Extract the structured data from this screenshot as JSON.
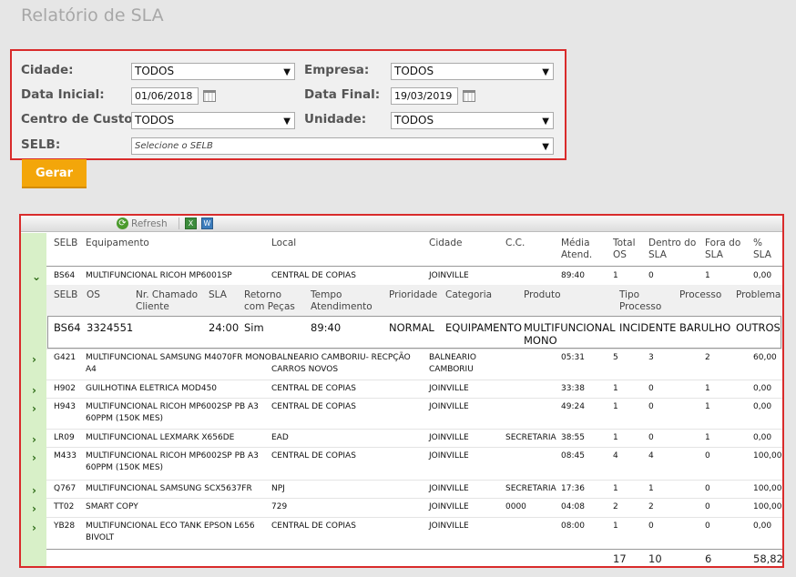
{
  "page_title": "Relatório de SLA",
  "filters": {
    "cidade_label": "Cidade:",
    "cidade_value": "TODOS",
    "empresa_label": "Empresa:",
    "empresa_value": "TODOS",
    "data_inicial_label": "Data Inicial:",
    "data_inicial_value": "01/06/2018",
    "data_final_label": "Data Final:",
    "data_final_value": "19/03/2019",
    "centro_label": "Centro de Custo:",
    "centro_value": "TODOS",
    "unidade_label": "Unidade:",
    "unidade_value": "TODOS",
    "selb_label": "SELB:",
    "selb_placeholder": "Selecione o SELB"
  },
  "gerar_label": "Gerar",
  "toolbar": {
    "refresh_label": "Refresh"
  },
  "columns": {
    "selb": "SELB",
    "equipamento": "Equipamento",
    "local": "Local",
    "cidade": "Cidade",
    "cc": "C.C.",
    "media1": "Média",
    "media2": "Atend.",
    "total1": "Total",
    "total2": "OS",
    "dentro1": "Dentro do",
    "dentro2": "SLA",
    "fora1": "Fora do",
    "fora2": "SLA",
    "pct1": "%",
    "pct2": "SLA"
  },
  "rows": [
    {
      "selb": "BS64",
      "equip": [
        "MULTIFUNCIONAL RICOH MP6001SP"
      ],
      "local": [
        "CENTRAL DE COPIAS"
      ],
      "cidade": [
        "JOINVILLE"
      ],
      "cc": "",
      "media": "89:40",
      "total": "1",
      "dentro": "0",
      "fora": "1",
      "pct": "0,00"
    },
    {
      "selb": "G421",
      "equip": [
        "MULTIFUNCIONAL SAMSUNG M4070FR MONO",
        "A4"
      ],
      "local": [
        "BALNEARIO CAMBORIU- RECPÇÃO",
        "CARROS NOVOS"
      ],
      "cidade": [
        "BALNEARIO",
        "CAMBORIU"
      ],
      "cc": "",
      "media": "05:31",
      "total": "5",
      "dentro": "3",
      "fora": "2",
      "pct": "60,00"
    },
    {
      "selb": "H902",
      "equip": [
        "GUILHOTINA ELETRICA MOD450"
      ],
      "local": [
        "CENTRAL DE COPIAS"
      ],
      "cidade": [
        "JOINVILLE"
      ],
      "cc": "",
      "media": "33:38",
      "total": "1",
      "dentro": "0",
      "fora": "1",
      "pct": "0,00"
    },
    {
      "selb": "H943",
      "equip": [
        "MULTIFUNCIONAL RICOH MP6002SP PB A3",
        "60PPM (150K MES)"
      ],
      "local": [
        "CENTRAL DE COPIAS"
      ],
      "cidade": [
        "JOINVILLE"
      ],
      "cc": "",
      "media": "49:24",
      "total": "1",
      "dentro": "0",
      "fora": "1",
      "pct": "0,00"
    },
    {
      "selb": "LR09",
      "equip": [
        "MULTIFUNCIONAL LEXMARK X656DE"
      ],
      "local": [
        "EAD"
      ],
      "cidade": [
        "JOINVILLE"
      ],
      "cc": "SECRETARIA",
      "media": "38:55",
      "total": "1",
      "dentro": "0",
      "fora": "1",
      "pct": "0,00"
    },
    {
      "selb": "M433",
      "equip": [
        "MULTIFUNCIONAL RICOH MP6002SP PB A3",
        "60PPM (150K MES)"
      ],
      "local": [
        "CENTRAL DE COPIAS"
      ],
      "cidade": [
        "JOINVILLE"
      ],
      "cc": "",
      "media": "08:45",
      "total": "4",
      "dentro": "4",
      "fora": "0",
      "pct": "100,00"
    },
    {
      "selb": "Q767",
      "equip": [
        "MULTIFUNCIONAL SAMSUNG SCX5637FR"
      ],
      "local": [
        "NPJ"
      ],
      "cidade": [
        "JOINVILLE"
      ],
      "cc": "SECRETARIA",
      "media": "17:36",
      "total": "1",
      "dentro": "1",
      "fora": "0",
      "pct": "100,00"
    },
    {
      "selb": "TT02",
      "equip": [
        "SMART COPY"
      ],
      "local": [
        "729"
      ],
      "cidade": [
        "JOINVILLE"
      ],
      "cc": "0000",
      "media": "04:08",
      "total": "2",
      "dentro": "2",
      "fora": "0",
      "pct": "100,00"
    },
    {
      "selb": "YB28",
      "equip": [
        "MULTIFUNCIONAL ECO TANK EPSON L656",
        "BIVOLT"
      ],
      "local": [
        "CENTRAL DE COPIAS"
      ],
      "cidade": [
        "JOINVILLE"
      ],
      "cc": "",
      "media": "08:00",
      "total": "1",
      "dentro": "0",
      "fora": "0",
      "pct": "0,00"
    }
  ],
  "subgrid": {
    "headers": {
      "selb": "SELB",
      "os": "OS",
      "chamado1": "Nr. Chamado",
      "chamado2": "Cliente",
      "sla": "SLA",
      "retorno1": "Retorno",
      "retorno2": "com Peças",
      "tempo1": "Tempo",
      "tempo2": "Atendimento",
      "prioridade": "Prioridade",
      "categoria": "Categoria",
      "produto": "Produto",
      "tipo1": "Tipo",
      "tipo2": "Processo",
      "processo": "Processo",
      "problema": "Problema"
    },
    "row": {
      "selb": "BS64",
      "os": "3324551",
      "chamado": "",
      "sla": "24:00",
      "retorno": "Sim",
      "tempo": "89:40",
      "prioridade": "NORMAL",
      "categoria": "EQUIPAMENTO",
      "produto1": "MULTIFUNCIONAL",
      "produto2": "MONO",
      "tipo": "INCIDENTE",
      "processo": "BARULHO",
      "problema": "OUTROS"
    }
  },
  "totals": {
    "total": "17",
    "dentro": "10",
    "fora": "6",
    "pct": "58,82"
  }
}
